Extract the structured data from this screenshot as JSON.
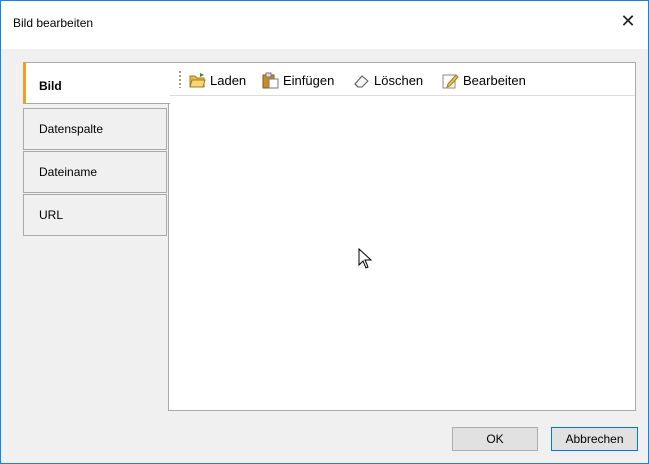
{
  "window": {
    "title": "Bild bearbeiten",
    "close_glyph": "✕"
  },
  "tabs": [
    {
      "label": "Bild",
      "active": true
    },
    {
      "label": "Datenspalte",
      "active": false
    },
    {
      "label": "Dateiname",
      "active": false
    },
    {
      "label": "URL",
      "active": false
    }
  ],
  "toolbar": {
    "load_label": "Laden",
    "paste_label": "Einfügen",
    "delete_label": "Löschen",
    "edit_label": "Bearbeiten"
  },
  "footer": {
    "ok_label": "OK",
    "cancel_label": "Abbrechen"
  },
  "colors": {
    "accent": "#0078d7",
    "active_tab_marker": "#f0a020",
    "window_border": "#1883d7"
  },
  "icons": [
    "folder-open-icon",
    "clipboard-paste-icon",
    "eraser-icon",
    "pencil-edit-icon",
    "mouse-pointer-icon"
  ]
}
